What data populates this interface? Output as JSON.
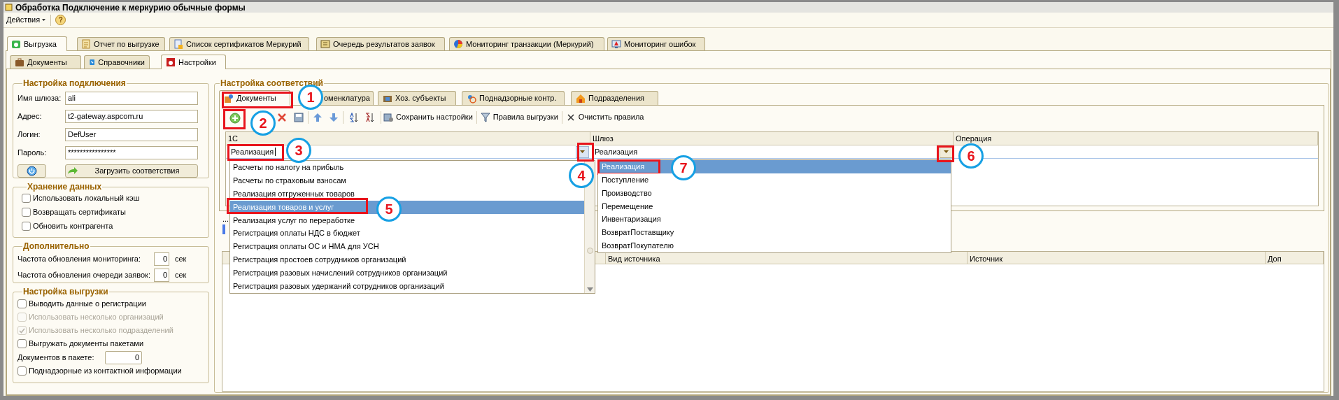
{
  "window": {
    "title": "Обработка  Подключение к меркурию обычные формы"
  },
  "menu": {
    "actions": "Действия",
    "help": "?"
  },
  "main_tabs": [
    {
      "label": "Выгрузка",
      "selected": true
    },
    {
      "label": "Отчет по выгрузке",
      "selected": false
    },
    {
      "label": "Список сертификатов Меркурий",
      "selected": false
    },
    {
      "label": "Очередь результатов заявок",
      "selected": false
    },
    {
      "label": "Мониторинг транзакции (Меркурий)",
      "selected": false
    },
    {
      "label": "Мониторинг ошибок",
      "selected": false
    }
  ],
  "sub_tabs": [
    {
      "label": "Документы",
      "selected": false
    },
    {
      "label": "Справочники",
      "selected": false
    },
    {
      "label": "Настройки",
      "selected": true
    }
  ],
  "connection": {
    "title": "Настройка подключения",
    "fields": [
      {
        "label": "Имя шлюза:",
        "value": "ali"
      },
      {
        "label": "Адрес:",
        "value": "t2-gateway.aspcom.ru"
      },
      {
        "label": "Логин:",
        "value": "DefUser"
      },
      {
        "label": "Пароль:",
        "value": "****************"
      }
    ],
    "load_button": "Загрузить соответствия"
  },
  "storage": {
    "title": "Хранение данных",
    "options": [
      {
        "label": "Использовать локальный кэш",
        "checked": false,
        "disabled": false
      },
      {
        "label": "Возвращать сертификаты",
        "checked": false,
        "disabled": false
      },
      {
        "label": "Обновить контрагента",
        "checked": false,
        "disabled": false
      }
    ]
  },
  "extra": {
    "title": "Дополнительно",
    "rows": [
      {
        "label": "Частота обновления мониторинга:",
        "value": "0",
        "unit": "сек"
      },
      {
        "label": "Частота обновления очереди заявок:",
        "value": "0",
        "unit": "сек"
      }
    ]
  },
  "export": {
    "title": "Настройка выгрузки",
    "items": [
      {
        "kind": "checkbox",
        "label": "Выводить данные о регистрации",
        "checked": false,
        "disabled": false
      },
      {
        "kind": "checkbox",
        "label": "Использовать несколько организаций",
        "checked": false,
        "disabled": true
      },
      {
        "kind": "checkbox",
        "label": "Использовать несколько подразделений",
        "checked": true,
        "disabled": true
      },
      {
        "kind": "checkbox",
        "label": "Выгружать документы пакетами",
        "checked": false,
        "disabled": false
      },
      {
        "kind": "number",
        "label": "Документов в пакете:",
        "value": "0"
      },
      {
        "kind": "checkbox",
        "label": "Поднадзорные из контактной информации",
        "checked": false,
        "disabled": false
      }
    ]
  },
  "mapping": {
    "title": "Настройка соответствий",
    "tabs": [
      {
        "label": "Документы",
        "selected": true
      },
      {
        "label": "оменклатура",
        "selected": false
      },
      {
        "label": "Хоз. субъекты",
        "selected": false
      },
      {
        "label": "Поднадзорные контр.",
        "selected": false
      },
      {
        "label": "Подразделения",
        "selected": false
      }
    ],
    "toolbar_buttons": [
      "Сохранить настройки",
      "Правила выгрузки",
      "Очистить правила"
    ],
    "table": {
      "columns": [
        "1С",
        "Шлюз",
        "Операция"
      ],
      "edit_row": {
        "column_1": "Реализация",
        "column_2": "Реализация"
      }
    },
    "dropdown_1c": [
      {
        "label": "Расчеты по налогу на прибыль",
        "selected": false
      },
      {
        "label": "Расчеты по страховым взносам",
        "selected": false
      },
      {
        "label": "Реализация отгруженных товаров",
        "selected": false
      },
      {
        "label": "Реализация товаров и услуг",
        "selected": true
      },
      {
        "label": "Реализация услуг по переработке",
        "selected": false
      },
      {
        "label": "Регистрация оплаты НДС в бюджет",
        "selected": false
      },
      {
        "label": "Регистрация оплаты ОС и НМА для УСН",
        "selected": false
      },
      {
        "label": "Регистрация простоев сотрудников организаций",
        "selected": false
      },
      {
        "label": "Регистрация разовых начислений сотрудников организаций",
        "selected": false
      },
      {
        "label": "Регистрация разовых удержаний сотрудников организаций",
        "selected": false
      }
    ],
    "dropdown_gateway": [
      {
        "label": "Реализация",
        "selected": true
      },
      {
        "label": "Поступление",
        "selected": false
      },
      {
        "label": "Производство",
        "selected": false
      },
      {
        "label": "Перемещение",
        "selected": false
      },
      {
        "label": "Инвентаризация",
        "selected": false
      },
      {
        "label": "ВозвратПоставщику",
        "selected": false
      },
      {
        "label": "ВозвратПокупателю",
        "selected": false
      }
    ],
    "ellipsis": "...",
    "lower_table": {
      "columns": [
        "Вид источника",
        "Источник",
        "Доп"
      ]
    }
  },
  "callouts": [
    "1",
    "2",
    "3",
    "4",
    "5",
    "6",
    "7"
  ]
}
